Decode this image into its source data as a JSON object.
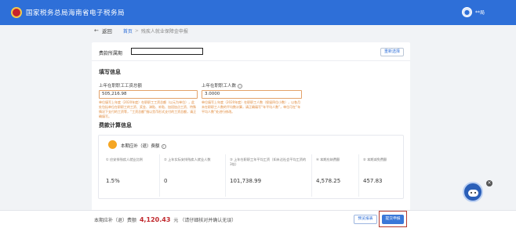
{
  "header": {
    "title": "国家税务总局海南省电子税务局",
    "user_name": "**局"
  },
  "breadcrumb": {
    "back_label": "返回",
    "items": [
      "首页",
      "残疾人就业保障金申报"
    ]
  },
  "period": {
    "label": "费款所属期",
    "reselect_label": "重新选择"
  },
  "fill_section": {
    "title": "填写信息",
    "salary_label": "上年在职职工工资总额",
    "salary_value": "505,216.98",
    "salary_hint": "单位填写上年度（2020年度）在职职工工资总额（以元为单位），此处包括单位在职职工的工资、奖金、津贴、补贴、加班加点工资、特殊情况下支付的工资等，“工资总额”指以货币形式支付的工资总额，请正确填写。",
    "headcount_label": "上年在职职工人数",
    "headcount_value": "3.0000",
    "headcount_hint": "单位填写上年度（2020年度）在职职工人数（保留四位小数），以各月末在职职工人数的平均数计算，请正确填写“年平均人数”，单位可在“年平均人数”处进行修改。"
  },
  "calc_section": {
    "title": "费款计算信息",
    "subtitle": "本期应补（退）费额",
    "columns": [
      {
        "head": "① 应安排残疾人就业比例",
        "value": "1.5%"
      },
      {
        "head": "② 上年实际安排残疾人就业人数",
        "value": "0"
      },
      {
        "head": "③ 上年在职职工年平均工资（如未达社会平均工资的3倍）",
        "value": "101,738.99"
      },
      {
        "head": "④ 本期应纳费额",
        "value": "4,578.25"
      },
      {
        "head": "⑤ 本期减免费额",
        "value": "457.83"
      }
    ]
  },
  "footer": {
    "label": "本期应补（退）费额",
    "amount": "4,120.43",
    "unit": "元",
    "note": "（请仔细核对并确认无误）",
    "draft_label": "预览报表",
    "submit_label": "提交申报"
  },
  "colors": {
    "header_bg": "#2e6fd8",
    "accent": "#3a78d8",
    "amount": "#c0282d",
    "hint": "#e08a3c"
  }
}
